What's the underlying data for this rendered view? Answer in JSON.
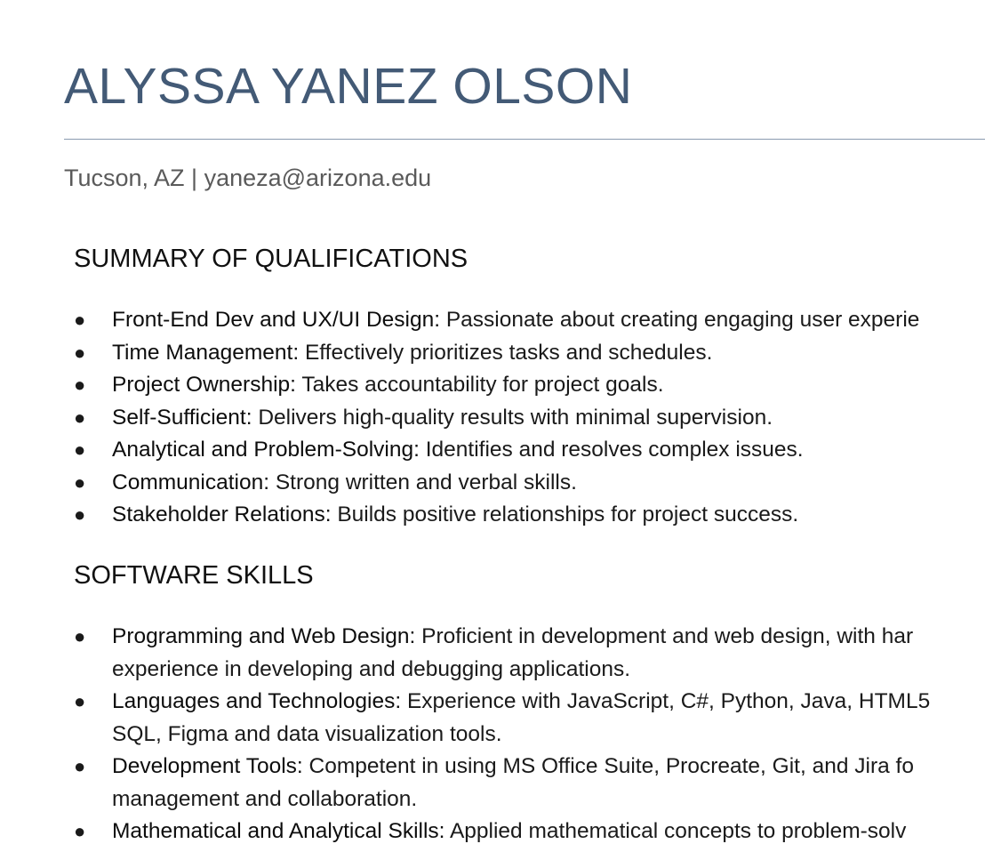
{
  "header": {
    "name": "ALYSSA YANEZ OLSON",
    "contact": "Tucson, AZ | yaneza@arizona.edu"
  },
  "summary": {
    "title": "SUMMARY OF QUALIFICATIONS",
    "items": [
      {
        "label": "Front-End Dev and UX/UI Design:",
        "text": " Passionate about creating engaging user experie"
      },
      {
        "label": "Time Management:",
        "text": " Effectively prioritizes tasks and schedules."
      },
      {
        "label": "Project Ownership:",
        "text": " Takes accountability for project goals."
      },
      {
        "label": "Self-Sufficient:",
        "text": " Delivers high-quality results with minimal supervision."
      },
      {
        "label": "Analytical and Problem-Solving:",
        "text": " Identifies and resolves complex issues."
      },
      {
        "label": "Communication:",
        "text": " Strong written and verbal skills."
      },
      {
        "label": "Stakeholder Relations:",
        "text": " Builds positive relationships for project success."
      }
    ]
  },
  "software": {
    "title": "SOFTWARE SKILLS",
    "items": [
      {
        "label": "Programming and Web Design:",
        "text": " Proficient in development and web design, with har",
        "text2": "experience in developing and debugging applications."
      },
      {
        "label": "Languages and Technologies:",
        "text": " Experience with JavaScript, C#, Python, Java, HTML5",
        "text2": "SQL, Figma and data visualization tools."
      },
      {
        "label": "Development Tools:",
        "text": " Competent in using MS Office Suite, Procreate, Git, and Jira fo",
        "text2": "management and collaboration."
      },
      {
        "label": "Mathematical and Analytical Skills:",
        "text": " Applied mathematical concepts to problem-solv",
        "text2": ""
      }
    ]
  },
  "colors": {
    "name": "#435a76",
    "rule": "#8a9ab0",
    "contact": "#5a5a5a"
  },
  "icons": {
    "bullet": "bullet-icon"
  }
}
